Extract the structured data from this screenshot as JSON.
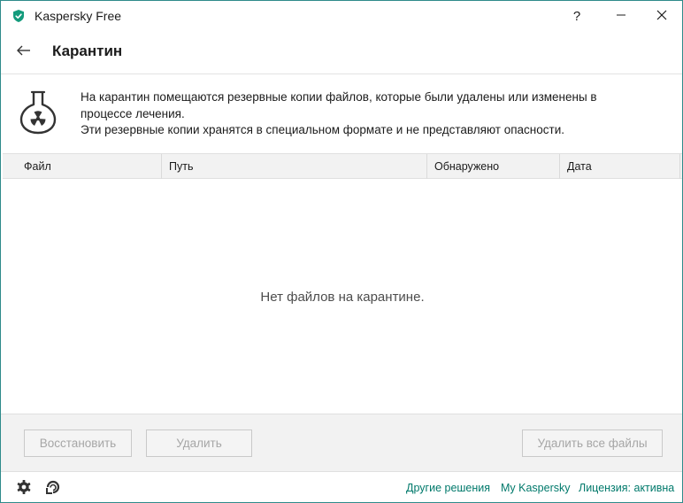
{
  "window": {
    "title": "Kaspersky Free",
    "help_glyph": "?",
    "minimize_glyph": "—",
    "close_glyph": "✕"
  },
  "header": {
    "title": "Карантин"
  },
  "info": {
    "line1": "На карантин помещаются резервные копии файлов, которые были удалены или изменены в",
    "line2": "процессе лечения.",
    "line3": "Эти резервные копии хранятся в специальном формате и не представляют опасности."
  },
  "table": {
    "columns": [
      "Файл",
      "Путь",
      "Обнаружено",
      "Дата"
    ],
    "rows": [],
    "empty_message": "Нет файлов на карантине."
  },
  "actions": {
    "restore_label": "Восстановить",
    "delete_label": "Удалить",
    "delete_all_label": "Удалить все файлы"
  },
  "footer": {
    "other_solutions": "Другие решения",
    "my_kaspersky": "My Kaspersky",
    "license": "Лицензия: активна"
  },
  "colors": {
    "accent": "#00796b",
    "window_border": "#2e8b8b",
    "disabled_text": "#a6a6a6",
    "panel_bg": "#f2f2f2"
  },
  "icons": {
    "app": "kaspersky-shield-icon",
    "back": "arrow-left-icon",
    "quarantine": "flask-radiation-icon",
    "settings": "gear-icon",
    "support": "support-icon"
  }
}
